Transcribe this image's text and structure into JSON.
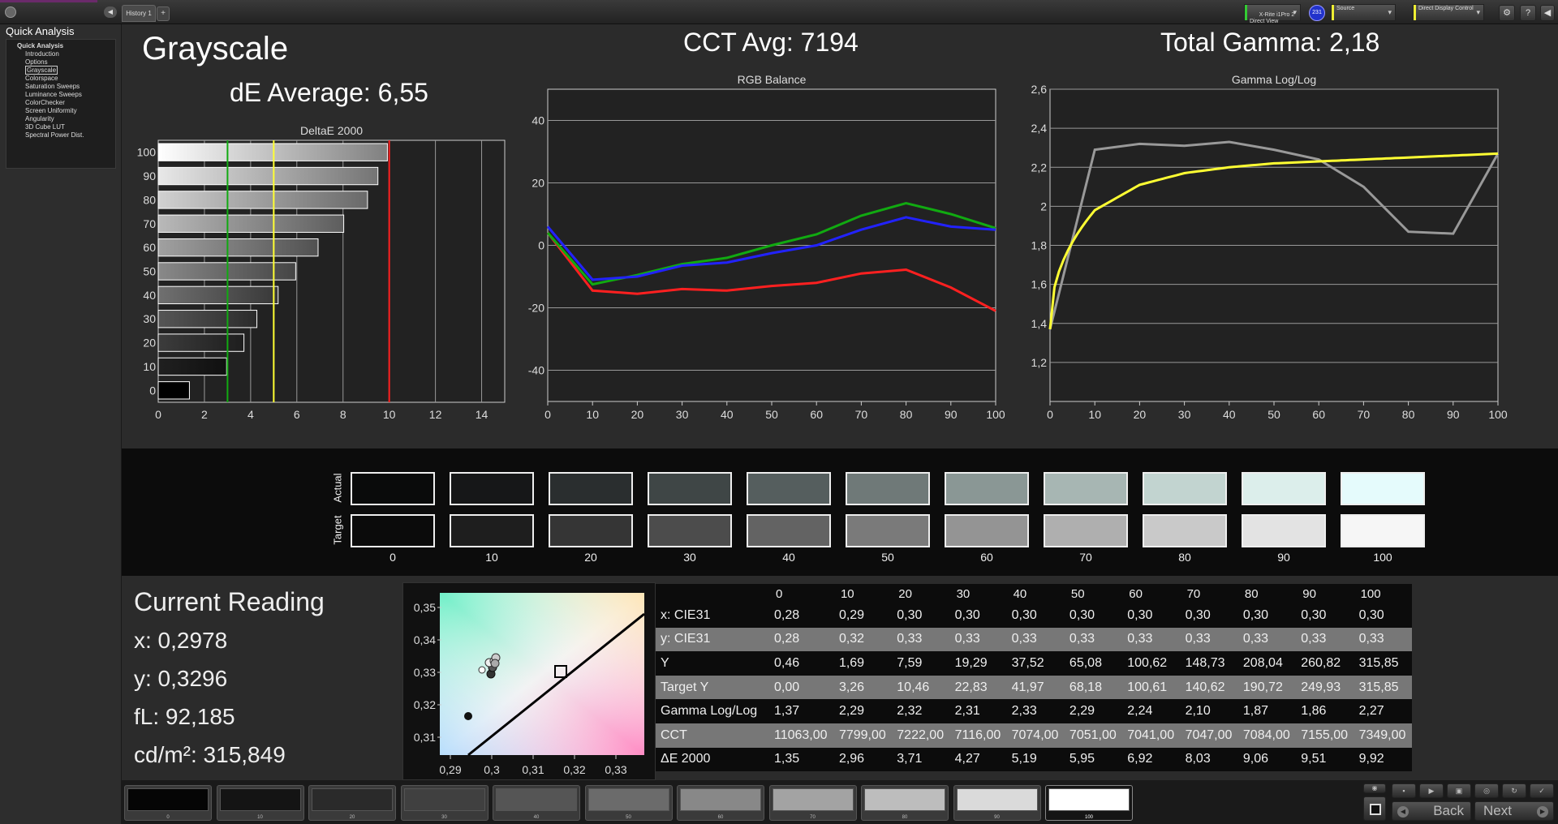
{
  "tabs": {
    "history": "History 1",
    "add": "+"
  },
  "toolbar": {
    "meter": "X-Rite i1Pro 2\nDirect View",
    "meter_badge": "231",
    "source": "Source",
    "display": "Direct Display Control"
  },
  "sidebar": {
    "title": "Quick Analysis",
    "root": "Quick Analysis",
    "items": [
      "Introduction",
      "Options",
      "Grayscale",
      "Colorspace",
      "Saturation Sweeps",
      "Luminance Sweeps",
      "ColorChecker",
      "Screen Uniformity",
      "Angularity",
      "3D Cube LUT",
      "Spectral Power Dist."
    ],
    "selected": "Grayscale"
  },
  "header": {
    "title": "Grayscale",
    "de_avg": "dE Average: 6,55",
    "cct_avg": "CCT Avg: 7194",
    "gamma": "Total Gamma: 2,18"
  },
  "colors": {
    "red": "#ff2020",
    "green": "#11aa11",
    "blue": "#2222ff",
    "yellow": "#ffff33",
    "gray": "#999999"
  },
  "chart_data": [
    {
      "type": "bar",
      "title": "DeltaE 2000",
      "categories": [
        "100",
        "90",
        "80",
        "70",
        "60",
        "50",
        "40",
        "30",
        "20",
        "10",
        "0"
      ],
      "values": [
        9.92,
        9.51,
        9.06,
        8.03,
        6.92,
        5.95,
        5.19,
        4.27,
        3.71,
        2.96,
        1.35
      ],
      "xticks": [
        "0",
        "2",
        "4",
        "6",
        "8",
        "10",
        "12",
        "14"
      ],
      "xlim": [
        0,
        15
      ],
      "thresholds": [
        {
          "value": 3,
          "color": "#11aa11"
        },
        {
          "value": 5,
          "color": "#ffff33"
        },
        {
          "value": 10,
          "color": "#ff2020"
        }
      ]
    },
    {
      "type": "line",
      "title": "RGB Balance",
      "x": [
        0,
        10,
        20,
        30,
        40,
        50,
        60,
        70,
        80,
        90,
        100
      ],
      "xticks": [
        "0",
        "10",
        "20",
        "30",
        "40",
        "50",
        "60",
        "70",
        "80",
        "90",
        "100"
      ],
      "yticks": [
        "40",
        "20",
        "0",
        "-20",
        "-40"
      ],
      "ylim": [
        -50,
        50
      ],
      "series": [
        {
          "color": "#ff2020",
          "values": [
            4,
            -14.5,
            -15.5,
            -14,
            -14.5,
            -13,
            -12,
            -9,
            -7.8,
            -13.5,
            -21
          ]
        },
        {
          "color": "#11aa11",
          "values": [
            4,
            -12.5,
            -9.5,
            -6,
            -4,
            0,
            3.5,
            9.5,
            13.5,
            10,
            5.5
          ]
        },
        {
          "color": "#2222ff",
          "values": [
            6,
            -11,
            -10,
            -6.5,
            -5.5,
            -2.5,
            0,
            5,
            9,
            6,
            5
          ]
        }
      ]
    },
    {
      "type": "line",
      "title": "Gamma Log/Log",
      "x": [
        0,
        10,
        20,
        30,
        40,
        50,
        60,
        70,
        80,
        90,
        100
      ],
      "xticks": [
        "0",
        "10",
        "20",
        "30",
        "40",
        "50",
        "60",
        "70",
        "80",
        "90",
        "100"
      ],
      "yticks": [
        "2,6",
        "2,4",
        "2,2",
        "2",
        "1,8",
        "1,6",
        "1,4",
        "1,2"
      ],
      "ylim": [
        1.0,
        2.6
      ],
      "series": [
        {
          "color": "#999999",
          "values": [
            1.37,
            2.29,
            2.32,
            2.31,
            2.33,
            2.29,
            2.24,
            2.1,
            1.87,
            1.86,
            2.27
          ]
        },
        {
          "color": "#ffff33",
          "curve": "target",
          "values": [
            1.37,
            1.98,
            2.11,
            2.17,
            2.2,
            2.22,
            2.23,
            2.24,
            2.25,
            2.26,
            2.27
          ]
        }
      ]
    }
  ],
  "swatches": {
    "actual_label": "Actual",
    "target_label": "Target",
    "labels": [
      "0",
      "10",
      "20",
      "30",
      "40",
      "50",
      "60",
      "70",
      "80",
      "90",
      "100"
    ],
    "actual": [
      "#0a0b0b",
      "#161718",
      "#2a2e2f",
      "#3f4646",
      "#555e5e",
      "#6f7978",
      "#8a9795",
      "#a7b6b3",
      "#c2d4d0",
      "#dceeeb",
      "#e5fbfc"
    ],
    "target": [
      "#0b0b0b",
      "#1e1e1e",
      "#353535",
      "#4c4c4c",
      "#636363",
      "#7a7a7a",
      "#949494",
      "#afafaf",
      "#c9c9c9",
      "#e3e3e3",
      "#f6f6f6"
    ]
  },
  "reading": {
    "title": "Current Reading",
    "x": "x: 0,2978",
    "y": "y: 0,3296",
    "fl": "fL: 92,185",
    "cd": "cd/m²: 315,849"
  },
  "cie": {
    "xticks": [
      "0,29",
      "0,3",
      "0,31",
      "0,32",
      "0,33"
    ],
    "yticks": [
      "0,35",
      "0,34",
      "0,33",
      "0,32",
      "0,31"
    ]
  },
  "table": {
    "columns": [
      "",
      "0",
      "10",
      "20",
      "30",
      "40",
      "50",
      "60",
      "70",
      "80",
      "90",
      "100"
    ],
    "rows": [
      [
        "x: CIE31",
        "0,28",
        "0,29",
        "0,30",
        "0,30",
        "0,30",
        "0,30",
        "0,30",
        "0,30",
        "0,30",
        "0,30",
        "0,30"
      ],
      [
        "y: CIE31",
        "0,28",
        "0,32",
        "0,33",
        "0,33",
        "0,33",
        "0,33",
        "0,33",
        "0,33",
        "0,33",
        "0,33",
        "0,33"
      ],
      [
        "Y",
        "0,46",
        "1,69",
        "7,59",
        "19,29",
        "37,52",
        "65,08",
        "100,62",
        "148,73",
        "208,04",
        "260,82",
        "315,85"
      ],
      [
        "Target Y",
        "0,00",
        "3,26",
        "10,46",
        "22,83",
        "41,97",
        "68,18",
        "100,61",
        "140,62",
        "190,72",
        "249,93",
        "315,85"
      ],
      [
        "Gamma Log/Log",
        "1,37",
        "2,29",
        "2,32",
        "2,31",
        "2,33",
        "2,29",
        "2,24",
        "2,10",
        "1,87",
        "1,86",
        "2,27"
      ],
      [
        "CCT",
        "11063,00",
        "7799,00",
        "7222,00",
        "7116,00",
        "7074,00",
        "7051,00",
        "7041,00",
        "7047,00",
        "7084,00",
        "7155,00",
        "7349,00"
      ],
      [
        "ΔE 2000",
        "1,35",
        "2,96",
        "3,71",
        "4,27",
        "5,19",
        "5,95",
        "6,92",
        "8,03",
        "9,06",
        "9,51",
        "9,92"
      ]
    ]
  },
  "bottom": {
    "patch_labels": [
      "0",
      "10",
      "20",
      "30",
      "40",
      "50",
      "60",
      "70",
      "80",
      "90",
      "100"
    ],
    "patch_colors": [
      "#050505",
      "#141414",
      "#2a2a2a",
      "#404040",
      "#555555",
      "#6b6b6b",
      "#888888",
      "#a3a3a3",
      "#bdbdbd",
      "#dadada",
      "#ffffff"
    ],
    "back": "Back",
    "next": "Next"
  }
}
